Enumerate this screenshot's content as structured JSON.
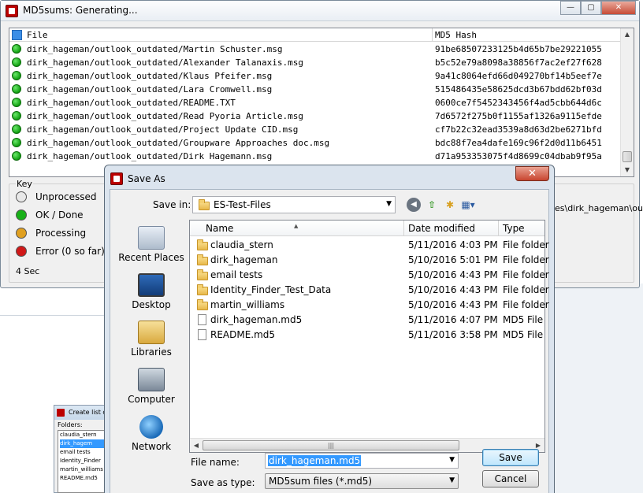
{
  "md5_window": {
    "title": "MD5sums: Generating...",
    "controls": {
      "minimize": "—",
      "maximize": "▢",
      "close": "✕"
    },
    "columns": {
      "file": "File",
      "hash": "MD5 Hash"
    },
    "rows": [
      {
        "file": "dirk_hageman/outlook_outdated/Martin Schuster.msg",
        "hash": "91be68507233125b4d65b7be29221055",
        "status": "ok"
      },
      {
        "file": "dirk_hageman/outlook_outdated/Alexander Talanaxis.msg",
        "hash": "b5c52e79a8098a38856f7ac2ef27f628",
        "status": "ok"
      },
      {
        "file": "dirk_hageman/outlook_outdated/Klaus Pfeifer.msg",
        "hash": "9a41c8064efd66d049270bf14b5eef7e",
        "status": "ok"
      },
      {
        "file": "dirk_hageman/outlook_outdated/Lara Cromwell.msg",
        "hash": "515486435e58625dcd3b67bdd62bf03d",
        "status": "ok"
      },
      {
        "file": "dirk_hageman/outlook_outdated/README.TXT",
        "hash": "0600ce7f5452343456f4ad5cbb644d6c",
        "status": "ok"
      },
      {
        "file": "dirk_hageman/outlook_outdated/Read Pyoria Article.msg",
        "hash": "7d6572f275b0f1155af1326a9115efde",
        "status": "ok"
      },
      {
        "file": "dirk_hageman/outlook_outdated/Project Update CID.msg",
        "hash": "cf7b22c32ead3539a8d63d2be6271bfd",
        "status": "ok"
      },
      {
        "file": "dirk_hageman/outlook_outdated/Groupware Approaches doc.msg",
        "hash": "bdc88f7ea4dafe169c96f2d0d11b6451",
        "status": "ok"
      },
      {
        "file": "dirk_hageman/outlook_outdated/Dirk Hagemann.msg",
        "hash": "d71a953353075f4d8699c04dbab9f95a",
        "status": "ok"
      }
    ],
    "key": {
      "title": "Key",
      "items": [
        {
          "label": "Unprocessed",
          "color": "#e8e8e8"
        },
        {
          "label": "OK / Done",
          "color": "#18b018"
        },
        {
          "label": "Processing",
          "color": "#e0a020"
        },
        {
          "label": "Error (0 so far)",
          "color": "#d01818"
        }
      ],
      "elapsed": "4 Sec",
      "path_tail": "es\\dirk_hageman\\ou"
    }
  },
  "small_window": {
    "title": "Create list of",
    "folders_label": "Folders:",
    "items": [
      "claudia_stern",
      "dirk_hagem",
      "email tests",
      "Identity_Finder",
      "martin_williams",
      "README.md5"
    ]
  },
  "save_dialog": {
    "title": "Save As",
    "close": "✕",
    "save_in_label": "Save in:",
    "save_in_value": "ES-Test-Files",
    "places": [
      "Recent Places",
      "Desktop",
      "Libraries",
      "Computer",
      "Network"
    ],
    "columns": {
      "name": "Name",
      "date": "Date modified",
      "type": "Type"
    },
    "files": [
      {
        "name": "claudia_stern",
        "date": "5/11/2016 4:03 PM",
        "type": "File folder",
        "kind": "folder"
      },
      {
        "name": "dirk_hageman",
        "date": "5/10/2016 5:01 PM",
        "type": "File folder",
        "kind": "folder"
      },
      {
        "name": "email tests",
        "date": "5/10/2016 4:43 PM",
        "type": "File folder",
        "kind": "folder"
      },
      {
        "name": "Identity_Finder_Test_Data",
        "date": "5/10/2016 4:43 PM",
        "type": "File folder",
        "kind": "folder"
      },
      {
        "name": "martin_williams",
        "date": "5/10/2016 4:43 PM",
        "type": "File folder",
        "kind": "folder"
      },
      {
        "name": "dirk_hageman.md5",
        "date": "5/11/2016 4:07 PM",
        "type": "MD5 File",
        "kind": "file"
      },
      {
        "name": "README.md5",
        "date": "5/11/2016 3:58 PM",
        "type": "MD5 File",
        "kind": "file"
      }
    ],
    "file_name_label": "File name:",
    "file_name_value": "dirk_hageman.md5",
    "save_type_label": "Save as type:",
    "save_type_value": "MD5sum files (*.md5)",
    "save_button": "Save",
    "cancel_button": "Cancel"
  }
}
